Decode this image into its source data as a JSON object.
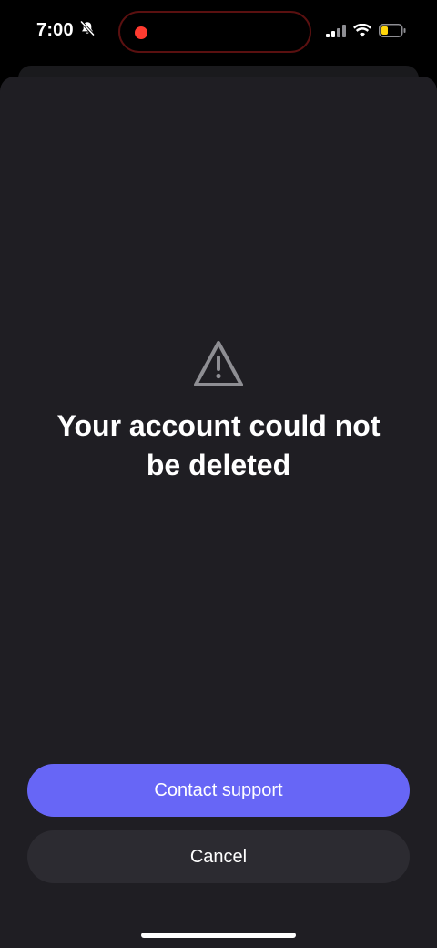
{
  "status_bar": {
    "time": "7:00",
    "recording_indicator_color": "#ff3b30",
    "icons": [
      "bell-slash-icon",
      "cellular-signal-icon",
      "wifi-icon",
      "battery-icon"
    ],
    "battery_color": "#ffd60a"
  },
  "dialog": {
    "icon": "warning-triangle-icon",
    "title": "Your account could not be deleted"
  },
  "actions": {
    "primary_label": "Contact support",
    "secondary_label": "Cancel"
  },
  "colors": {
    "accent": "#6766f6",
    "sheet_background": "#1f1e23",
    "secondary_button": "#2c2b31"
  }
}
